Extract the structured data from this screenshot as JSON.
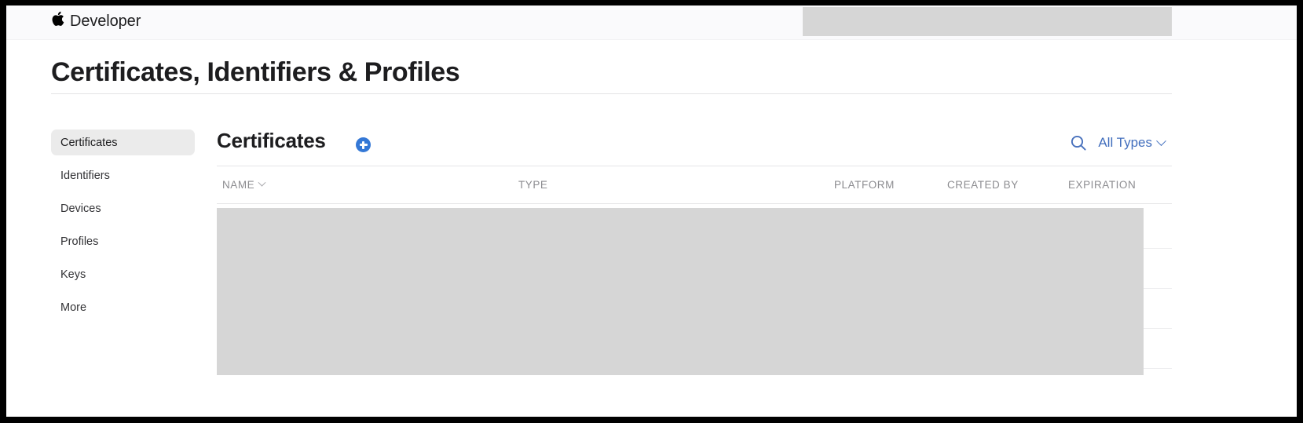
{
  "window": {
    "frame_color": "#000000",
    "page_background": "#ffffff"
  },
  "globalnav": {
    "apple_glyph": "",
    "brand_label": "Developer",
    "background": "#fafafc",
    "redaction": {
      "present": true,
      "color": "#d6d6d6",
      "note": "account/menu area obscured"
    }
  },
  "header": {
    "page_title": "Certificates, Identifiers & Profiles"
  },
  "sidebar": {
    "items": [
      {
        "label": "Certificates",
        "active": true
      },
      {
        "label": "Identifiers",
        "active": false
      },
      {
        "label": "Devices",
        "active": false
      },
      {
        "label": "Profiles",
        "active": false
      },
      {
        "label": "Keys",
        "active": false
      },
      {
        "label": "More",
        "active": false
      }
    ],
    "active_background": "#ebebeb"
  },
  "main": {
    "section_title": "Certificates",
    "add_button": {
      "label": "+",
      "icon": "plus-circle-icon",
      "color": "#3478d6"
    },
    "toolbar": {
      "search_icon": "search-icon",
      "type_filter_label": "All Types",
      "type_filter_chevron": "chevron-down-icon",
      "accent_color": "#416ebd"
    },
    "table": {
      "columns": [
        {
          "key": "name",
          "label": "NAME",
          "sortable": true,
          "sort_indicator": "chevron-down-icon"
        },
        {
          "key": "type",
          "label": "TYPE",
          "sortable": false
        },
        {
          "key": "platform",
          "label": "PLATFORM",
          "sortable": false
        },
        {
          "key": "created_by",
          "label": "CREATED BY",
          "sortable": false
        },
        {
          "key": "expiration",
          "label": "EXPIRATION",
          "sortable": false
        }
      ],
      "rows": [],
      "row_count_visible": 5,
      "body_redaction": {
        "present": true,
        "color": "#d6d6d6",
        "note": "certificate rows obscured"
      }
    }
  }
}
